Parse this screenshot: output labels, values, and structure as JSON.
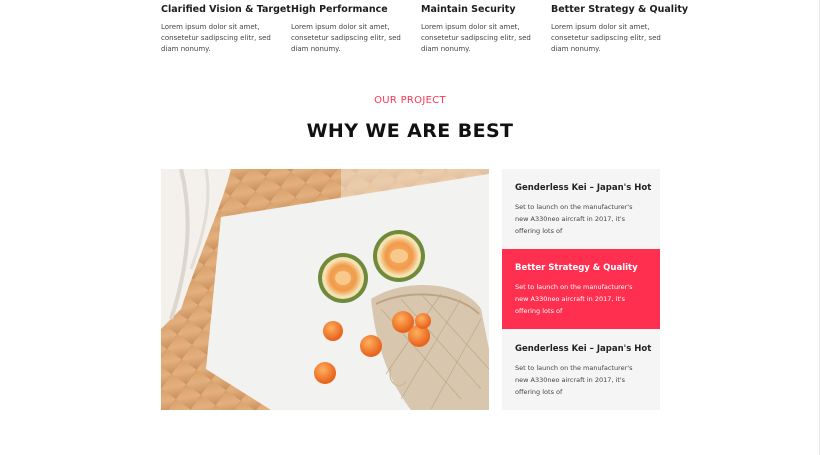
{
  "features": [
    {
      "title": "Clarified Vision & Target",
      "text": "Lorem ipsum dolor sit amet, consetetur sadipscing elitr, sed diam nonumy."
    },
    {
      "title": "High Performance",
      "text": "Lorem ipsum dolor sit amet, consetetur sadipscing elitr, sed diam nonumy."
    },
    {
      "title": "Maintain Security",
      "text": "Lorem ipsum dolor sit amet, consetetur sadipscing elitr, sed diam nonumy."
    },
    {
      "title": "Better Strategy & Quality",
      "text": "Lorem ipsum dolor sit amet, consetetur sadipscing elitr, sed diam nonumy."
    }
  ],
  "section": {
    "eyebrow": "OUR PROJECT",
    "title": "WHY WE ARE BEST"
  },
  "cards": [
    {
      "title": "Genderless Kei – Japan's Hot",
      "text": "Set to launch on the manufacturer's new A330neo aircraft in 2017, it's offering lots of",
      "active": false
    },
    {
      "title": "Better Strategy & Quality",
      "text": "Set to launch on the manufacturer's new A330neo aircraft in 2017, it's offering lots of",
      "active": true
    },
    {
      "title": "Genderless Kei – Japan's Hot",
      "text": "Set to launch on the manufacturer's new A330neo aircraft in 2017, it's offering lots of",
      "active": false
    }
  ],
  "colors": {
    "accent": "#ff2f4f",
    "card_bg": "#f5f5f5",
    "heading": "#111111"
  }
}
